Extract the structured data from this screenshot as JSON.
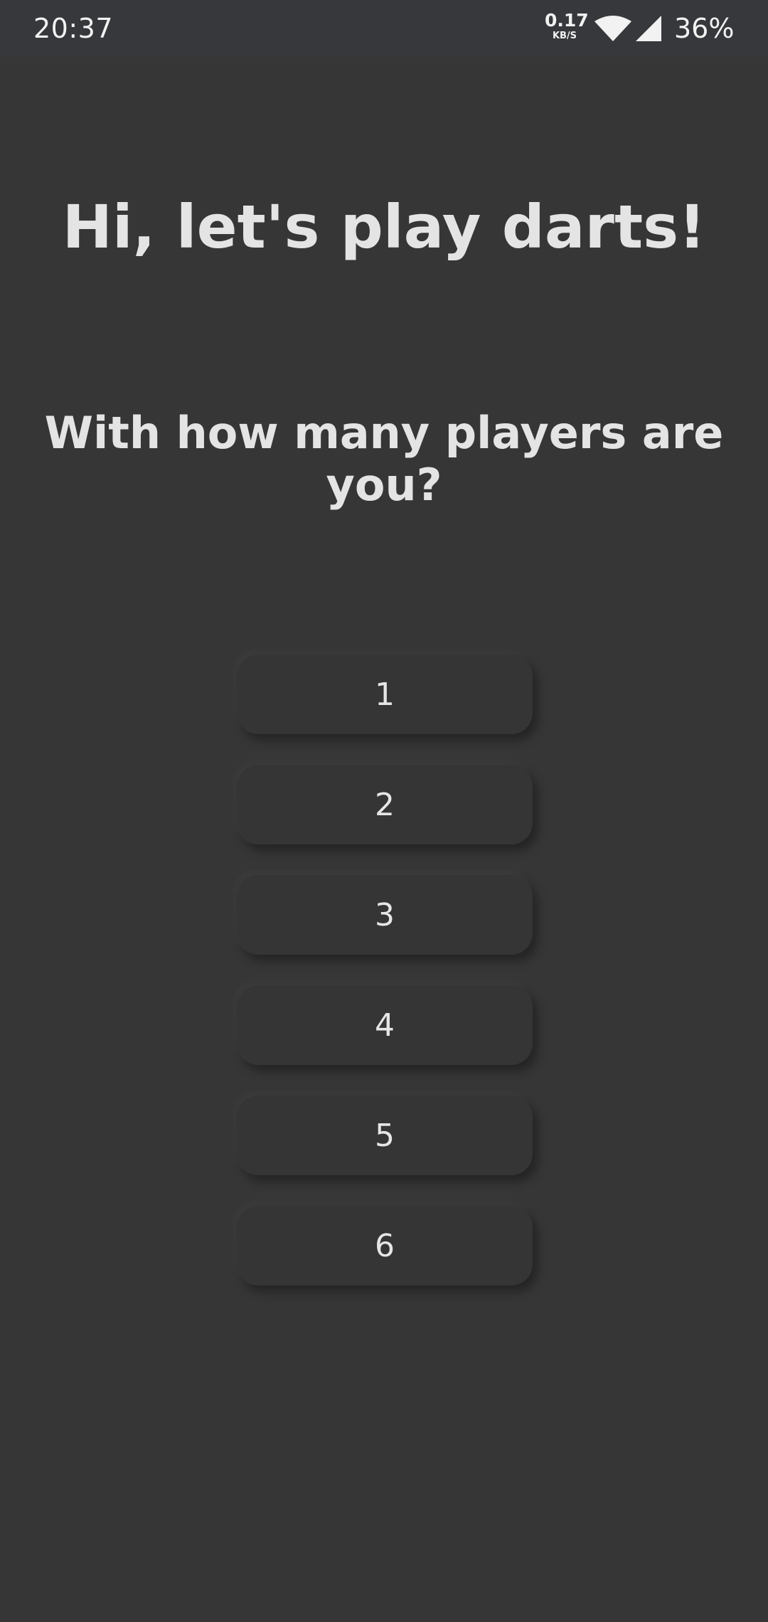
{
  "status_bar": {
    "time": "20:37",
    "net_speed_value": "0.17",
    "net_speed_unit": "KB/S",
    "wifi_icon": "wifi-icon",
    "signal_icon": "cell-signal-icon",
    "battery": "36%"
  },
  "main": {
    "title": "Hi, let's play darts!",
    "question": "With how many players are you?"
  },
  "player_options": [
    "1",
    "2",
    "3",
    "4",
    "5",
    "6"
  ],
  "colors": {
    "background": "#363636",
    "status_bar": "#37383c",
    "text": "#e4e4e4",
    "button": "#353535"
  }
}
